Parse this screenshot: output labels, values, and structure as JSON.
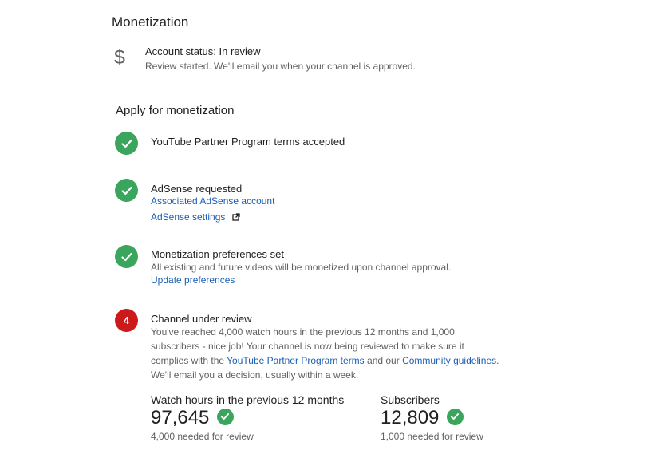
{
  "page": {
    "title": "Monetization"
  },
  "account_status": {
    "icon": "dollar-icon",
    "title": "Account status: In review",
    "description": "Review started. We'll email you when your channel is approved."
  },
  "apply": {
    "title": "Apply for monetization",
    "steps": [
      {
        "status": "done",
        "title": "YouTube Partner Program terms accepted"
      },
      {
        "status": "done",
        "title": "AdSense requested",
        "links": [
          "Associated AdSense account",
          "AdSense settings"
        ]
      },
      {
        "status": "done",
        "title": "Monetization preferences set",
        "description": "All existing and future videos will be monetized upon channel approval.",
        "link": "Update preferences"
      },
      {
        "status": "pending",
        "number": "4",
        "title": "Channel under review",
        "description_line1": "You've reached 4,000 watch hours in the previous 12 months and 1,000",
        "description_line2": "subscribers - nice job! Your channel is now being reviewed to make sure it",
        "description_line3_pre": "complies with the ",
        "description_link1": "YouTube Partner Program terms",
        "description_line3_mid": " and our ",
        "description_link2": "Community guidelines",
        "description_line3_post": ".",
        "description_line4": "We'll email you a decision, usually within a week."
      }
    ]
  },
  "stats": {
    "watch_hours": {
      "label": "Watch hours in the previous 12 months",
      "value": "97,645",
      "note": "4,000 needed for review"
    },
    "subscribers": {
      "label": "Subscribers",
      "value": "12,809",
      "note": "1,000 needed for review"
    }
  },
  "colors": {
    "check_green": "#3aa55c",
    "alert_red": "#cc1a1a",
    "link_blue": "#1a5fb4",
    "muted_text": "#606060"
  }
}
